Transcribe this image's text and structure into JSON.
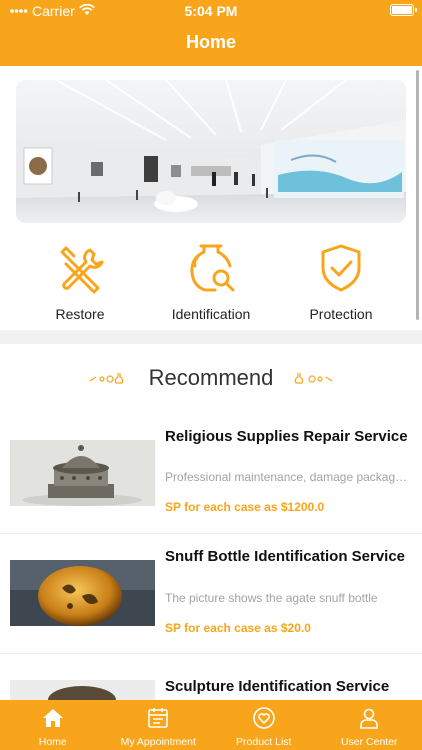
{
  "status": {
    "carrier": "Carrier",
    "time": "5:04 PM"
  },
  "nav": {
    "title": "Home"
  },
  "categories": [
    {
      "label": "Restore",
      "icon": "wrench-screwdriver-icon"
    },
    {
      "label": "Identification",
      "icon": "vase-search-icon"
    },
    {
      "label": "Protection",
      "icon": "shield-check-icon"
    }
  ],
  "recommend": {
    "title": "Recommend"
  },
  "items": [
    {
      "title": "Religious Supplies Repair Service",
      "desc": "Professional maintenance, damage package repair",
      "price": "SP for each case as $1200.0"
    },
    {
      "title": "Snuff Bottle Identification Service",
      "desc": "The picture shows the agate snuff bottle",
      "price": "SP for each case as $20.0"
    },
    {
      "title": "Sculpture Identification Service",
      "desc": "",
      "price": ""
    }
  ],
  "tabs": [
    {
      "label": "Home",
      "icon": "home-icon"
    },
    {
      "label": "My Appointment",
      "icon": "calendar-icon"
    },
    {
      "label": "Product List",
      "icon": "heart-icon"
    },
    {
      "label": "User Center",
      "icon": "user-icon"
    }
  ],
  "colors": {
    "accent": "#f9a51b",
    "divider": "#f1f1f4",
    "text": "#111111",
    "muted": "#a3a3a3"
  }
}
